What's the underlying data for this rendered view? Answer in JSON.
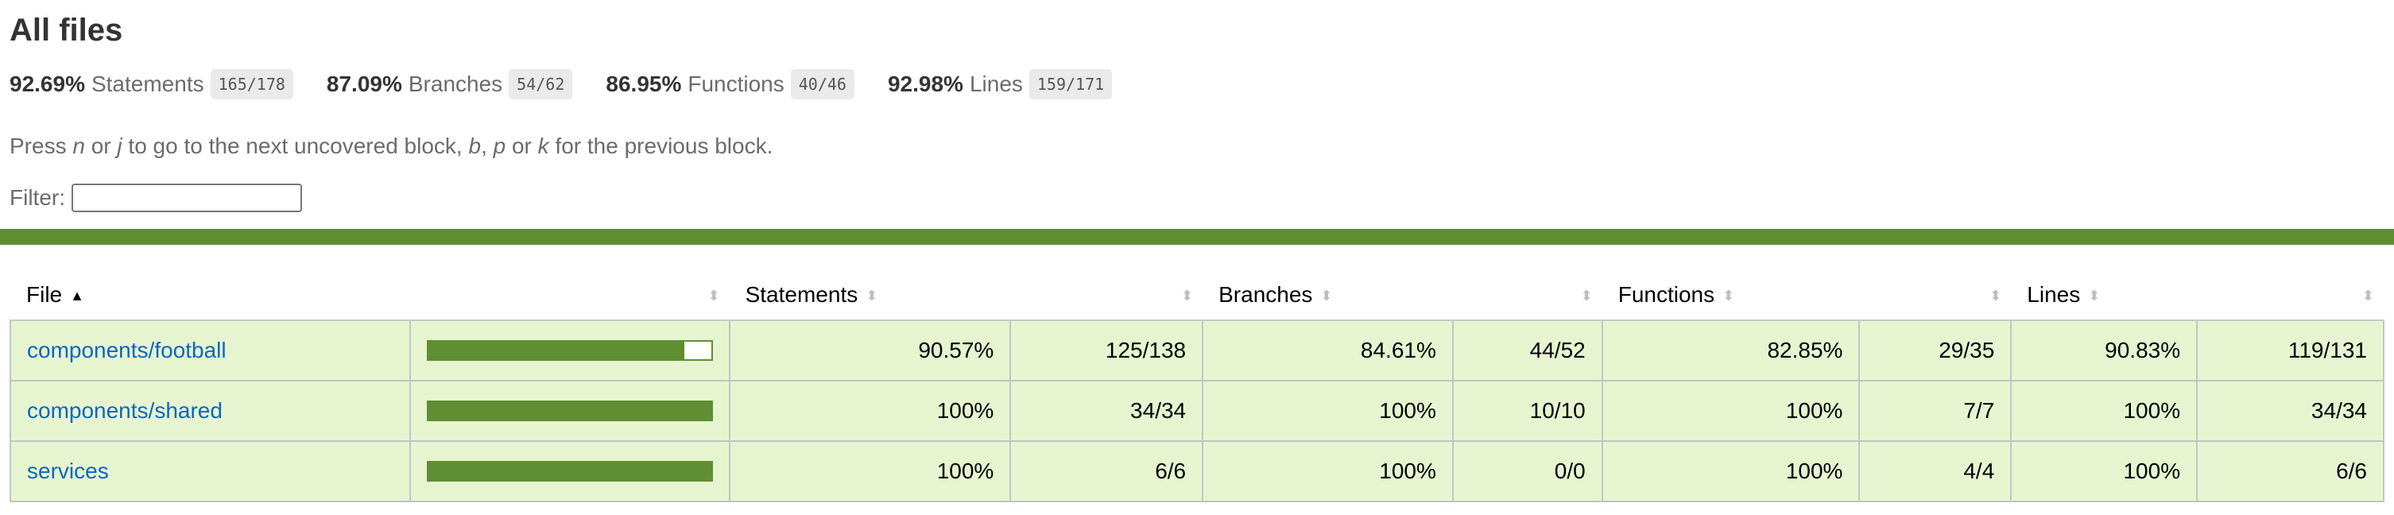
{
  "title": "All files",
  "summary": [
    {
      "pct": "92.69%",
      "label": "Statements",
      "frac": "165/178"
    },
    {
      "pct": "87.09%",
      "label": "Branches",
      "frac": "54/62"
    },
    {
      "pct": "86.95%",
      "label": "Functions",
      "frac": "40/46"
    },
    {
      "pct": "92.98%",
      "label": "Lines",
      "frac": "159/171"
    }
  ],
  "hint": {
    "p1": "Press ",
    "k1": "n",
    "p2": " or ",
    "k2": "j",
    "p3": " to go to the next uncovered block, ",
    "k3": "b",
    "p4": ", ",
    "k4": "p",
    "p5": " or ",
    "k5": "k",
    "p6": " for the previous block."
  },
  "filter": {
    "label": "Filter:",
    "value": ""
  },
  "colors": {
    "high": "#5f8e33",
    "row_bg": "#e6f5d0",
    "link": "#0b66c3"
  },
  "table": {
    "headers": {
      "file": "File",
      "statements": "Statements",
      "branches": "Branches",
      "functions": "Functions",
      "lines": "Lines"
    },
    "rows": [
      {
        "file": "components/football",
        "coverage": 0.9057,
        "stmt_pct": "90.57%",
        "stmt_frac": "125/138",
        "br_pct": "84.61%",
        "br_frac": "44/52",
        "fn_pct": "82.85%",
        "fn_frac": "29/35",
        "ln_pct": "90.83%",
        "ln_frac": "119/131"
      },
      {
        "file": "components/shared",
        "coverage": 1.0,
        "stmt_pct": "100%",
        "stmt_frac": "34/34",
        "br_pct": "100%",
        "br_frac": "10/10",
        "fn_pct": "100%",
        "fn_frac": "7/7",
        "ln_pct": "100%",
        "ln_frac": "34/34"
      },
      {
        "file": "services",
        "coverage": 1.0,
        "stmt_pct": "100%",
        "stmt_frac": "6/6",
        "br_pct": "100%",
        "br_frac": "0/0",
        "fn_pct": "100%",
        "fn_frac": "4/4",
        "ln_pct": "100%",
        "ln_frac": "6/6"
      }
    ]
  }
}
